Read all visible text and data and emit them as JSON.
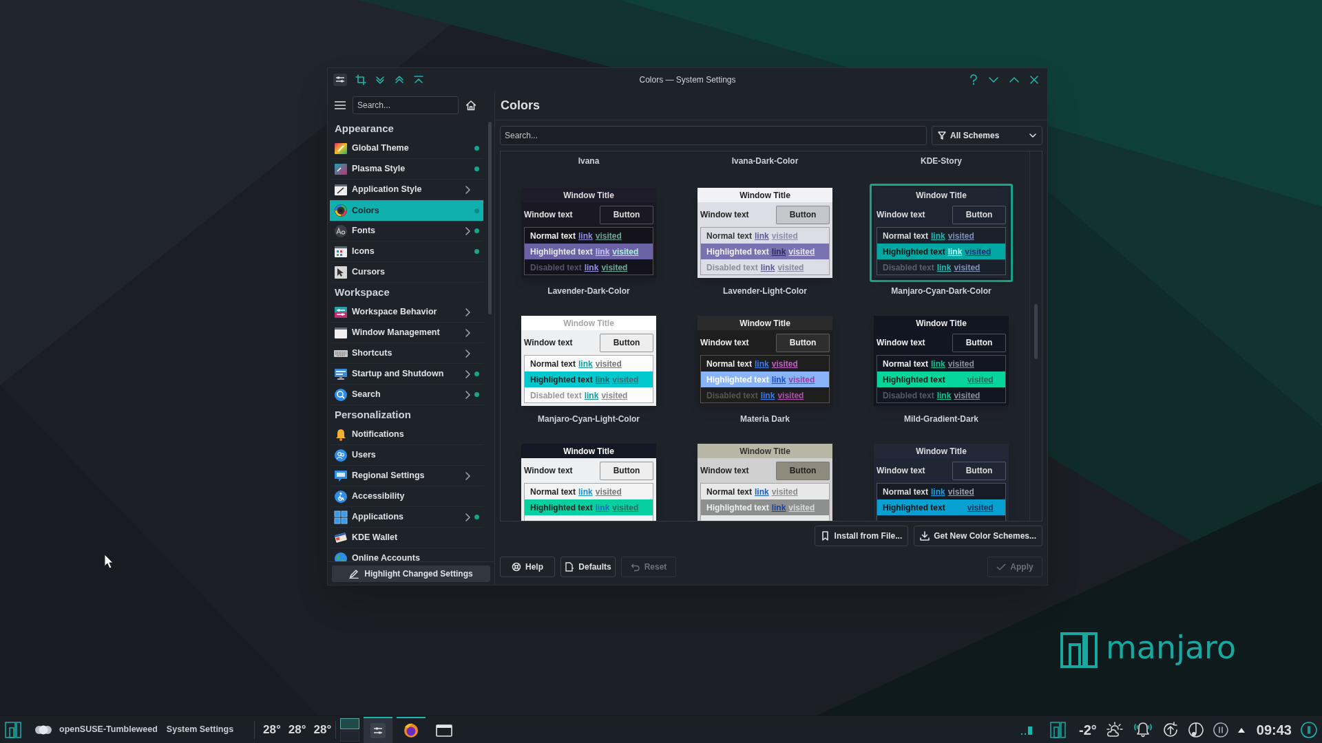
{
  "window": {
    "title": "Colors — System Settings"
  },
  "sidebar": {
    "search": {
      "placeholder": "Search..."
    },
    "sections": [
      {
        "title": "Appearance",
        "items": [
          {
            "label": "Global Theme",
            "has_submenu": false,
            "changed": true,
            "selected": false
          },
          {
            "label": "Plasma Style",
            "has_submenu": false,
            "changed": true,
            "selected": false
          },
          {
            "label": "Application Style",
            "has_submenu": true,
            "changed": false,
            "selected": false
          },
          {
            "label": "Colors",
            "has_submenu": false,
            "changed": true,
            "selected": true
          },
          {
            "label": "Fonts",
            "has_submenu": true,
            "changed": true,
            "selected": false
          },
          {
            "label": "Icons",
            "has_submenu": false,
            "changed": true,
            "selected": false
          },
          {
            "label": "Cursors",
            "has_submenu": false,
            "changed": false,
            "selected": false
          }
        ]
      },
      {
        "title": "Workspace",
        "items": [
          {
            "label": "Workspace Behavior",
            "has_submenu": true,
            "changed": false,
            "selected": false
          },
          {
            "label": "Window Management",
            "has_submenu": true,
            "changed": false,
            "selected": false
          },
          {
            "label": "Shortcuts",
            "has_submenu": true,
            "changed": false,
            "selected": false
          },
          {
            "label": "Startup and Shutdown",
            "has_submenu": true,
            "changed": true,
            "selected": false
          },
          {
            "label": "Search",
            "has_submenu": true,
            "changed": true,
            "selected": false
          }
        ]
      },
      {
        "title": "Personalization",
        "items": [
          {
            "label": "Notifications",
            "has_submenu": false,
            "changed": false,
            "selected": false
          },
          {
            "label": "Users",
            "has_submenu": false,
            "changed": false,
            "selected": false
          },
          {
            "label": "Regional Settings",
            "has_submenu": true,
            "changed": false,
            "selected": false
          },
          {
            "label": "Accessibility",
            "has_submenu": false,
            "changed": false,
            "selected": false
          },
          {
            "label": "Applications",
            "has_submenu": true,
            "changed": true,
            "selected": false
          },
          {
            "label": "KDE Wallet",
            "has_submenu": false,
            "changed": false,
            "selected": false
          },
          {
            "label": "Online Accounts",
            "has_submenu": false,
            "changed": false,
            "selected": false
          }
        ]
      }
    ],
    "footer_button": "Highlight Changed Settings"
  },
  "page": {
    "title": "Colors",
    "search": {
      "placeholder": "Search..."
    },
    "filter": "All Schemes",
    "column_labels": [
      "Ivana",
      "Ivana-Dark-Color",
      "KDE-Story"
    ],
    "schemes": [
      {
        "name": "Lavender-Dark-Color",
        "selected": false,
        "title": "Window Title",
        "window_text": "Window text",
        "button": "Button",
        "rows": [
          {
            "kind": "normal",
            "text": "Normal text",
            "link": "link",
            "visited": "visited"
          },
          {
            "kind": "highlighted",
            "text": "Highlighted text",
            "link": "link",
            "visited": "visited"
          },
          {
            "kind": "disabled",
            "text": "Disabled text",
            "link": "link",
            "visited": "visited"
          }
        ]
      },
      {
        "name": "Lavender-Light-Color",
        "selected": false,
        "title": "Window Title",
        "window_text": "Window text",
        "button": "Button",
        "rows": [
          {
            "kind": "normal",
            "text": "Normal text",
            "link": "link",
            "visited": "visited"
          },
          {
            "kind": "highlighted",
            "text": "Highlighted text",
            "link": "link",
            "visited": "visited"
          },
          {
            "kind": "disabled",
            "text": "Disabled text",
            "link": "link",
            "visited": "visited"
          }
        ]
      },
      {
        "name": "Manjaro-Cyan-Dark-Color",
        "selected": true,
        "title": "Window Title",
        "window_text": "Window text",
        "button": "Button",
        "rows": [
          {
            "kind": "normal",
            "text": "Normal text",
            "link": "link",
            "visited": "visited"
          },
          {
            "kind": "highlighted",
            "text": "Highlighted text",
            "link": "link",
            "visited": "visited"
          },
          {
            "kind": "disabled",
            "text": "Disabled text",
            "link": "link",
            "visited": "visited"
          }
        ]
      },
      {
        "name": "Manjaro-Cyan-Light-Color",
        "selected": false,
        "title": "Window Title",
        "window_text": "Window text",
        "button": "Button",
        "rows": [
          {
            "kind": "normal",
            "text": "Normal text",
            "link": "link",
            "visited": "visited"
          },
          {
            "kind": "highlighted",
            "text": "Highlighted text",
            "link": "link",
            "visited": "visited"
          },
          {
            "kind": "disabled",
            "text": "Disabled text",
            "link": "link",
            "visited": "visited"
          }
        ]
      },
      {
        "name": "Materia Dark",
        "selected": false,
        "title": "Window Title",
        "window_text": "Window text",
        "button": "Button",
        "rows": [
          {
            "kind": "normal",
            "text": "Normal text",
            "link": "link",
            "visited": "visited"
          },
          {
            "kind": "highlighted",
            "text": "Highlighted text",
            "link": "link",
            "visited": "visited"
          },
          {
            "kind": "disabled",
            "text": "Disabled text",
            "link": "link",
            "visited": "visited"
          }
        ]
      },
      {
        "name": "Mild-Gradient-Dark",
        "selected": false,
        "title": "Window Title",
        "window_text": "Window text",
        "button": "Button",
        "rows": [
          {
            "kind": "normal",
            "text": "Normal text",
            "link": "link",
            "visited": "visited"
          },
          {
            "kind": "highlighted",
            "text": "Highlighted text",
            "visited": "visited"
          },
          {
            "kind": "disabled",
            "text": "Disabled text",
            "link": "link",
            "visited": "visited"
          }
        ]
      },
      {
        "selected": false,
        "title": "Window Title",
        "window_text": "Window text",
        "button": "Button",
        "rows": [
          {
            "kind": "normal",
            "text": "Normal text",
            "link": "link",
            "visited": "visited"
          },
          {
            "kind": "highlighted",
            "text": "Highlighted text",
            "link": "link",
            "visited": "visited"
          }
        ]
      },
      {
        "selected": false,
        "title": "Window Title",
        "window_text": "Window text",
        "button": "Button",
        "rows": [
          {
            "kind": "normal",
            "text": "Normal text",
            "link": "link",
            "visited": "visited"
          },
          {
            "kind": "highlighted",
            "text": "Highlighted text",
            "link": "link",
            "visited": "visited"
          }
        ]
      },
      {
        "selected": false,
        "title": "Window Title",
        "window_text": "Window text",
        "button": "Button",
        "rows": [
          {
            "kind": "normal",
            "text": "Normal text",
            "link": "link",
            "visited": "visited"
          },
          {
            "kind": "highlighted",
            "text": "Highlighted text",
            "visited": "visited"
          }
        ]
      }
    ],
    "actions": [
      "Install from File...",
      "Get New Color Schemes..."
    ],
    "buttons": [
      {
        "label": "Help",
        "disabled": false
      },
      {
        "label": "Defaults",
        "disabled": false
      },
      {
        "label": "Reset",
        "disabled": true
      },
      {
        "label": "Apply",
        "disabled": true
      }
    ]
  },
  "taskbar": {
    "activity": "openSUSE-Tumbleweed",
    "window": "System Settings",
    "temperatures": [
      "28°",
      "28°",
      "28°"
    ],
    "tasks": [
      {
        "selected": true,
        "running": true
      },
      {
        "selected": false,
        "running": true
      },
      {
        "selected": false,
        "running": false
      }
    ],
    "weather": "-2°",
    "clock": "09:43"
  },
  "desktop": {
    "logo": "manjaro"
  }
}
